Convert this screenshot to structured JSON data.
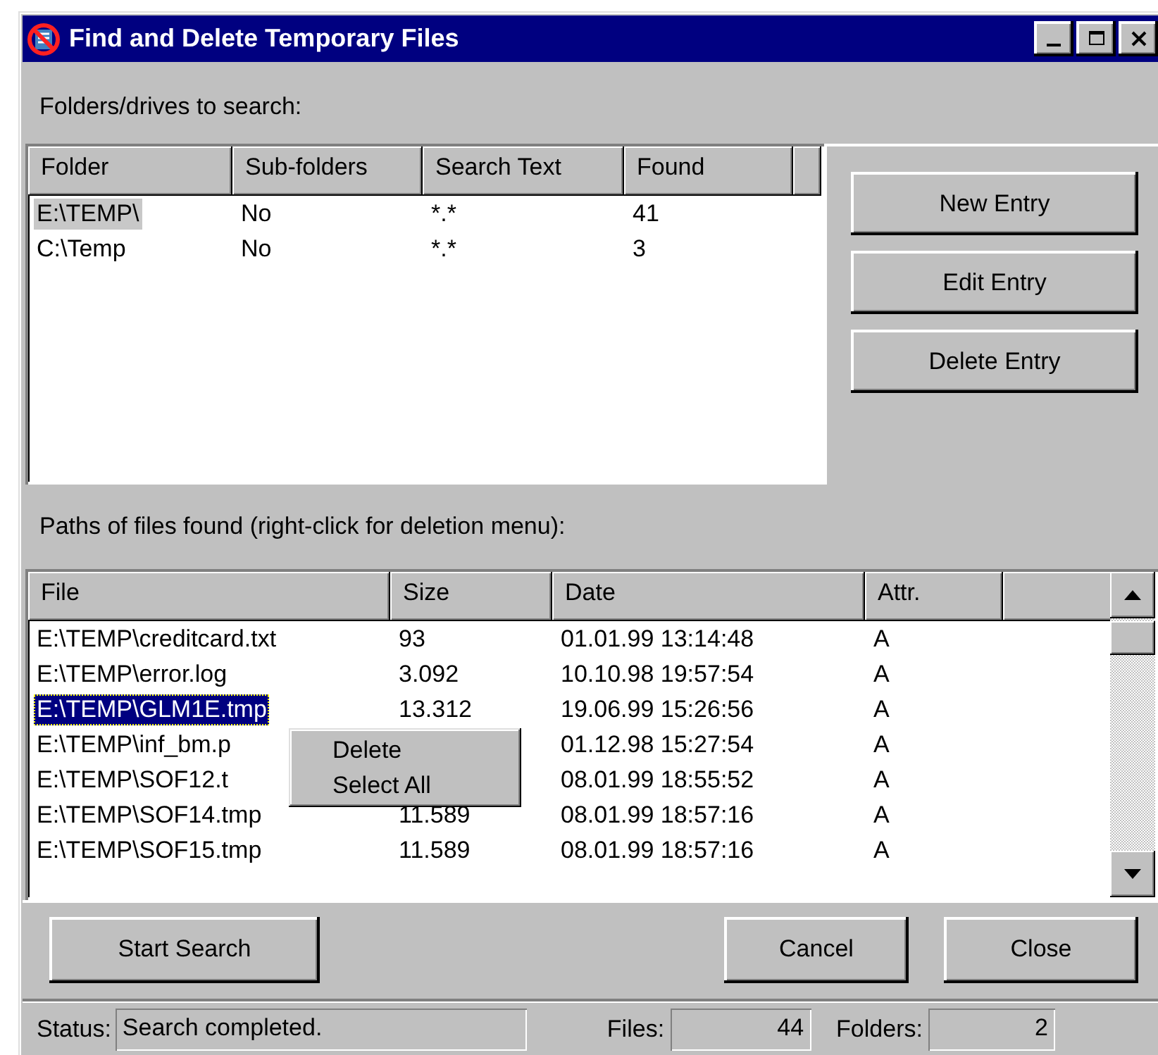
{
  "window": {
    "title": "Find and Delete Temporary Files"
  },
  "folders_label": "Folders/drives to search:",
  "folders_table": {
    "columns": [
      "Folder",
      "Sub-folders",
      "Search Text",
      "Found"
    ],
    "rows": [
      {
        "cells": [
          "E:\\TEMP\\",
          "No",
          "*.*",
          "41"
        ],
        "selected": true
      },
      {
        "cells": [
          "C:\\Temp",
          "No",
          "*.*",
          "3"
        ],
        "selected": false
      }
    ]
  },
  "entry_buttons": [
    "New Entry",
    "Edit Entry",
    "Delete Entry"
  ],
  "files_label": "Paths of files found (right-click for deletion menu):",
  "files_table": {
    "columns": [
      "File",
      "Size",
      "Date",
      "Attr."
    ],
    "rows": [
      {
        "cells": [
          "E:\\TEMP\\creditcard.txt",
          "93",
          "01.01.99 13:14:48",
          "A"
        ],
        "selected": false
      },
      {
        "cells": [
          "E:\\TEMP\\error.log",
          "3.092",
          "10.10.98 19:57:54",
          "A"
        ],
        "selected": false
      },
      {
        "cells": [
          "E:\\TEMP\\GLM1E.tmp",
          "13.312",
          "19.06.99 15:26:56",
          "A"
        ],
        "selected": true
      },
      {
        "cells": [
          "E:\\TEMP\\inf_bm.p",
          null,
          "01.12.98 15:27:54",
          "A"
        ],
        "selected": false
      },
      {
        "cells": [
          "E:\\TEMP\\SOF12.t",
          null,
          "08.01.99 18:55:52",
          "A"
        ],
        "selected": false
      },
      {
        "cells": [
          "E:\\TEMP\\SOF14.tmp",
          "11.589",
          "08.01.99 18:57:16",
          "A"
        ],
        "selected": false
      },
      {
        "cells": [
          "E:\\TEMP\\SOF15.tmp",
          "11.589",
          "08.01.99 18:57:16",
          "A"
        ],
        "selected": false
      }
    ]
  },
  "context_menu": [
    "Delete",
    "Select All"
  ],
  "action_buttons": [
    "Start Search",
    "Cancel",
    "Close"
  ],
  "status_bar": {
    "status_label": "Status:",
    "status": "Search completed.",
    "files_label": "Files:",
    "files": "44",
    "folders_label": "Folders:",
    "folders": "2"
  }
}
